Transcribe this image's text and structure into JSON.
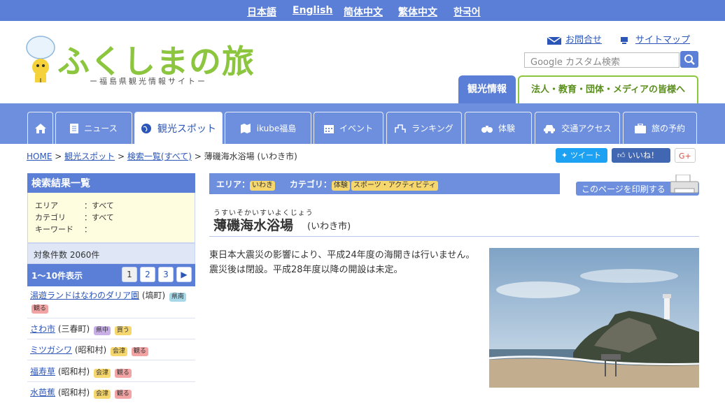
{
  "languages": [
    "日本語",
    "English",
    "简体中文",
    "繁体中文",
    "한국어"
  ],
  "header": {
    "logo_text": "ふくしまの旅",
    "logo_sub": "ー福島県観光情報サイトー",
    "contact": "お問合せ",
    "sitemap": "サイトマップ",
    "search_placeholder": "Google カスタム検索",
    "tab_kanko": "観光情報",
    "tab_hojin": "法人・教育・団体・メディアの皆様へ"
  },
  "nav": [
    {
      "label": ""
    },
    {
      "label": "ニュース"
    },
    {
      "label": "観光スポット"
    },
    {
      "label": "ikube福島"
    },
    {
      "label": "イベント"
    },
    {
      "label": "ランキング"
    },
    {
      "label": "体験"
    },
    {
      "label": "交通アクセス"
    },
    {
      "label": "旅の予約"
    }
  ],
  "breadcrumb": {
    "home": "HOME",
    "spot": "観光スポット",
    "list": "検索一覧(すべて)",
    "current": "薄磯海水浴場 (いわき市)",
    "sep": ">"
  },
  "sns": {
    "tweet": "ツイート",
    "like": "いいね！ 0",
    "gplus": "G+"
  },
  "sidebar": {
    "title": "検索結果一覧",
    "cond": [
      {
        "k": "エリア",
        "v": "：すべて"
      },
      {
        "k": "カテゴリ",
        "v": "：すべて"
      },
      {
        "k": "キーワード",
        "v": "："
      }
    ],
    "count": "対象件数 2060件",
    "range": "1〜10件表示",
    "pages": [
      "1",
      "2",
      "3",
      "▶"
    ],
    "results": [
      {
        "name": "湯遊ランドはなわのダリア園",
        "place": "(塙町)",
        "tags": [
          "県南",
          "観る"
        ]
      },
      {
        "name": "さわ市",
        "place": "(三春町)",
        "tags": [
          "県中",
          "買う"
        ]
      },
      {
        "name": "ミツガシワ",
        "place": "(昭和村)",
        "tags": [
          "会津",
          "観る"
        ]
      },
      {
        "name": "福寿草",
        "place": "(昭和村)",
        "tags": [
          "会津",
          "観る"
        ]
      },
      {
        "name": "水芭蕉",
        "place": "(昭和村)",
        "tags": [
          "会津",
          "観る"
        ]
      }
    ]
  },
  "main": {
    "area_label": "エリア：",
    "area_value": "いわき",
    "category_label": "カテゴリ：",
    "category_tags": [
      "体験",
      "スポーツ・アクティビティ"
    ],
    "print": "このページを印刷する",
    "ruby": "うすいそかいすいよくじょう",
    "title": "薄磯海水浴場",
    "title_sub": "(いわき市)",
    "description": "東日本大震災の影響により、平成24年度の海開きは行いません。震災後は閉設。平成28年度以降の開設は未定。"
  }
}
